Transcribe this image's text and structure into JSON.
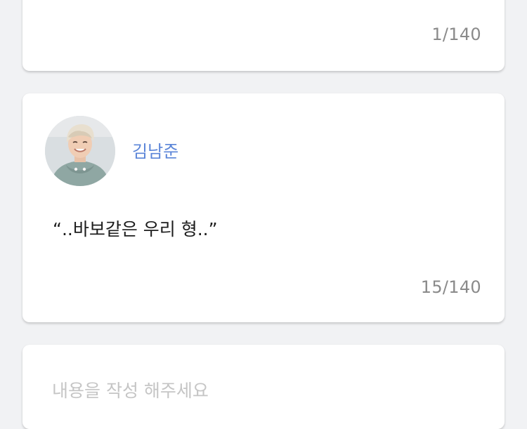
{
  "cards": [
    {
      "counter": "1/140"
    },
    {
      "author_name": "김남준",
      "quote": "“..바보같은 우리 형..”",
      "counter": "15/140"
    },
    {
      "placeholder": "내용을 작성 해주세요"
    }
  ],
  "colors": {
    "background": "#f1f2f4",
    "card": "#ffffff",
    "author_name": "#5b85d8",
    "counter": "#8a8a8a",
    "placeholder": "#c5c5c5"
  }
}
